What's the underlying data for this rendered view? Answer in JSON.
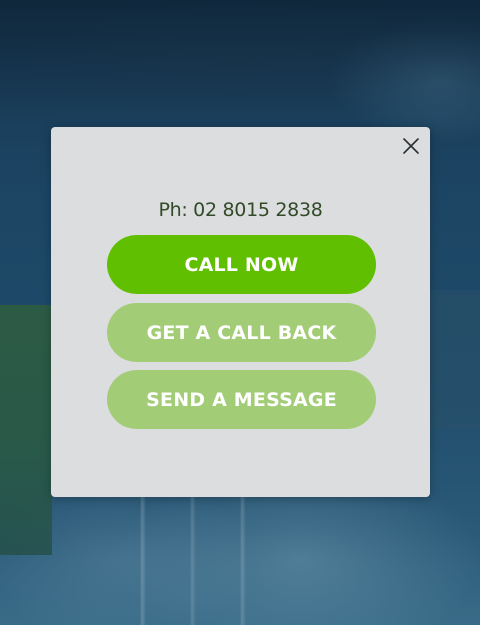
{
  "popup": {
    "close_icon": "close-icon",
    "phone_text": "Ph: 02 8015 2838",
    "buttons": {
      "call_now": "CALL NOW",
      "get_call_back": "GET A CALL BACK",
      "send_message": "SEND A MESSAGE"
    }
  },
  "colors": {
    "primary_green": "#61bf01",
    "light_green": "#a2cd76",
    "modal_bg": "#dcdddf",
    "phone_text": "#324a28",
    "background": "#1d4868"
  }
}
